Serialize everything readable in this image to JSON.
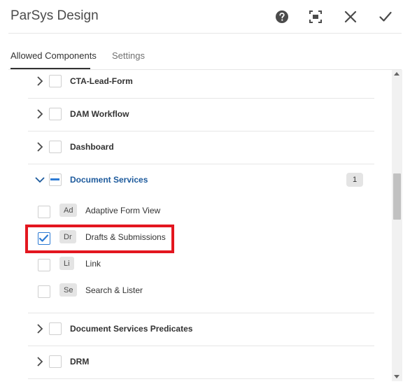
{
  "dialog": {
    "title": "ParSys Design",
    "actions": [
      "help-icon",
      "fullscreen-icon",
      "close-icon",
      "check-icon"
    ]
  },
  "tabs": [
    {
      "label": "Allowed Components",
      "active": true
    },
    {
      "label": "Settings",
      "active": false
    }
  ],
  "groups": [
    {
      "label": "CTA-Lead-Form",
      "expanded": false
    },
    {
      "label": "DAM Workflow",
      "expanded": false
    },
    {
      "label": "Dashboard",
      "expanded": false
    },
    {
      "label": "Document Services",
      "expanded": true,
      "selected_count": "1"
    },
    {
      "label": "Document Services Predicates",
      "expanded": false
    },
    {
      "label": "DRM",
      "expanded": false
    }
  ],
  "components": [
    {
      "abbr": "Ad",
      "label": "Adaptive Form View",
      "checked": false
    },
    {
      "abbr": "Dr",
      "label": "Drafts & Submissions",
      "checked": true
    },
    {
      "abbr": "Li",
      "label": "Link",
      "checked": false
    },
    {
      "abbr": "Se",
      "label": "Search & Lister",
      "checked": false
    }
  ],
  "colors": {
    "accent": "#2d7bd4",
    "expanded_label": "#1d5a9c",
    "highlight": "#e3161f"
  }
}
